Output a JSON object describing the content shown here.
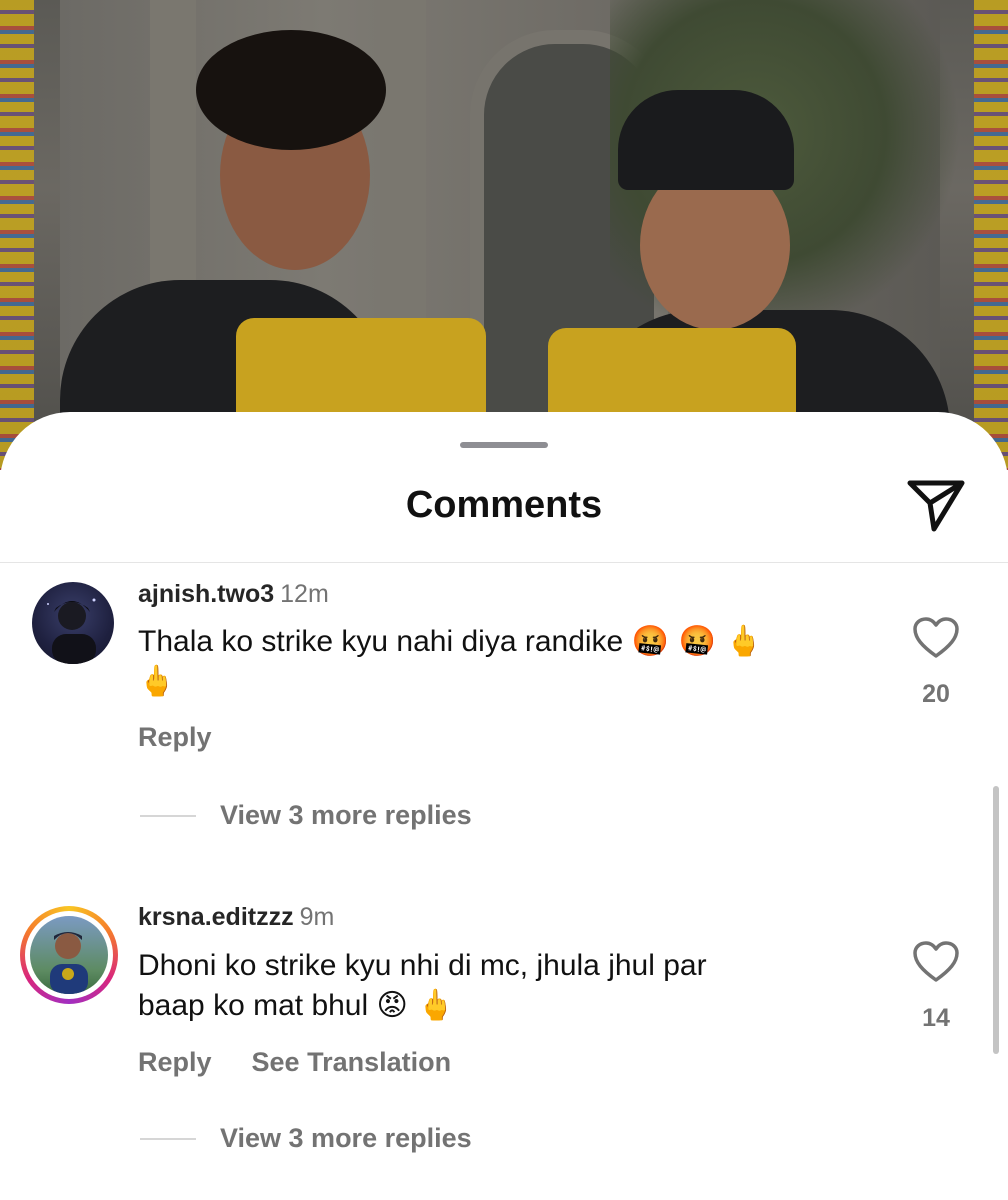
{
  "sheet": {
    "title": "Comments"
  },
  "comments": [
    {
      "username": "ajnish.two3",
      "time": "12m",
      "text": "Thala ko strike kyu nahi diya randike",
      "emojis_line1": "🤬 🤬 🖕",
      "emojis_line2": "🖕",
      "likes": "20",
      "reply_label": "Reply",
      "view_replies": "View 3 more replies"
    },
    {
      "username": "krsna.editzzz",
      "time": "9m",
      "text_line1": "Dhoni ko strike kyu nhi di mc, jhula jhul par",
      "text_line2": "baap ko mat bhul",
      "emojis": "😡 🖕",
      "likes": "14",
      "reply_label": "Reply",
      "translate_label": "See Translation",
      "view_replies": "View 3 more replies"
    }
  ],
  "icons": {
    "share": "paper-plane-icon",
    "like": "heart-outline-icon"
  },
  "colors": {
    "text_primary": "#111111",
    "text_secondary": "#737373",
    "story_ring": "#d8267d"
  }
}
